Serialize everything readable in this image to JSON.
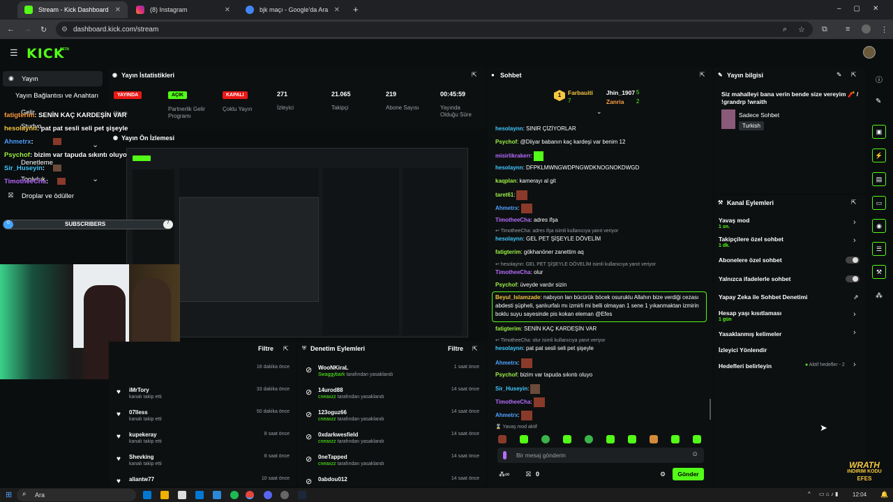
{
  "browser": {
    "tabs": [
      {
        "label": "Stream - Kick Dashboard",
        "active": true
      },
      {
        "label": "(8) Instagram",
        "active": false
      },
      {
        "label": "bjk maçı - Google'da Ara",
        "active": false
      }
    ],
    "url": "dashboard.kick.com/stream"
  },
  "kick": {
    "logo": "KICK",
    "beta": "BETA"
  },
  "sidebar": {
    "items": [
      {
        "label": "Yayın"
      },
      {
        "label": "Yayın Bağlantısı ve Anahtarı"
      },
      {
        "label": "Gelir"
      },
      {
        "label": "Studyo"
      },
      {
        "label": "Denetleme"
      },
      {
        "label": "Topluluk"
      },
      {
        "label": "Droplar ve ödüller"
      }
    ]
  },
  "overlay": {
    "chat": [
      {
        "user": "fatigterim",
        "text": ": SENİN KAÇ KARDEŞİN VAR"
      },
      {
        "user": "hesolaynn",
        "text": ": pat pat sesli seli pet şişeyle"
      },
      {
        "user": "Ahmetrx",
        "text": ":"
      },
      {
        "user": "Psychof",
        "text": ": bizim var tapuda sıkıntı oluyo"
      },
      {
        "user": "Sir_Huseyin",
        "text": ":"
      },
      {
        "user": "TimotheeCha",
        "text": ":"
      }
    ],
    "subs_label": "SUBSCRIBERS",
    "subs_left": "0",
    "subs_right": "7"
  },
  "stats": {
    "title": "Yayın İstatistikleri",
    "items": [
      {
        "badge": "YAYINDA",
        "label": "Yayın"
      },
      {
        "badge": "AÇIK",
        "label": "Partnerlik Gelir Programı"
      },
      {
        "badge": "KAPALI",
        "label": "Çoklu Yayın"
      },
      {
        "value": "271",
        "label": "İzleyici"
      },
      {
        "value": "21.065",
        "label": "Takipçi"
      },
      {
        "value": "219",
        "label": "Abone Sayısı"
      },
      {
        "value": "00:45:59",
        "label": "Yayında Olduğu Süre"
      }
    ]
  },
  "preview": {
    "title": "Yayın Ön İzlemesi"
  },
  "activity": {
    "filter": "Filtre",
    "items": [
      {
        "name": "",
        "sub": "",
        "time": "16 dakika önce"
      },
      {
        "name": "iMrTory",
        "sub": "kanalı takip etti",
        "time": "33 dakika önce"
      },
      {
        "name": "07lless",
        "sub": "kanalı takip etti",
        "time": "50 dakika önce"
      },
      {
        "name": "kupekeray",
        "sub": "kanalı takip etti",
        "time": "8 saat önce"
      },
      {
        "name": "Shevking",
        "sub": "kanalı takip etti",
        "time": "8 saat önce"
      },
      {
        "name": "aliantw77",
        "sub": "",
        "time": "10 saat önce"
      }
    ]
  },
  "moderation": {
    "title": "Denetim Eylemleri",
    "filter": "Filtre",
    "items": [
      {
        "name": "WooNKiraL",
        "by": "Swaggybark",
        "sub": "tarafından yasaklandı",
        "time": "1 saat önce"
      },
      {
        "name": "14urod88",
        "by": "cneaxzz",
        "sub": "tarafından yasaklandı",
        "time": "14 saat önce"
      },
      {
        "name": "123oguz66",
        "by": "cneaxzz",
        "sub": "tarafından yasaklandı",
        "time": "14 saat önce"
      },
      {
        "name": "0xdarkwesfield",
        "by": "cneaxzz",
        "sub": "tarafından yasaklandı",
        "time": "14 saat önce"
      },
      {
        "name": "0neTapped",
        "by": "cneaxzz",
        "sub": "tarafından yasaklandı",
        "time": "14 saat önce"
      },
      {
        "name": "0abdou012",
        "by": "",
        "sub": "",
        "time": "14 saat önce"
      }
    ]
  },
  "chat": {
    "title": "Sohbet",
    "top": [
      {
        "name": "Farbauiti",
        "count": "7"
      },
      {
        "name": "Jhin_1907",
        "count": "5"
      },
      {
        "name": "Zanria",
        "count": "2"
      }
    ],
    "lines": [
      {
        "user": "hesolaynn",
        "text": ": SINIR ÇİZİYORLAR"
      },
      {
        "user": "Psychof",
        "text": ": @Diiyar babanın kaç kardeşi var benim 12"
      },
      {
        "user": "misirlikrakerr",
        "text": ":"
      },
      {
        "user": "hesolaynn",
        "text": ": DFPKLMWNGWDPNGWDKNOGNOKDWGD"
      },
      {
        "user": "kaqplan",
        "text": ": kamerayı al git"
      },
      {
        "user": "taret61",
        "text": ":"
      },
      {
        "user": "Ahmetrx",
        "text": ":"
      },
      {
        "user": "TimotheeCha",
        "text": ": adres ifşa"
      },
      {
        "user": "",
        "text": "TimotheeCha: adres ifşa isimli kullanıcıya yanıt veriyor"
      },
      {
        "user": "hesolaynn",
        "text": ": GEL PET ŞİŞEYLE DÖVELİM"
      },
      {
        "user": "fatigterim",
        "text": ": gökhanöner zanettim aq"
      },
      {
        "user": "",
        "text": "hesolaynn: GEL PET ŞİŞEYLE DÖVELİM isimli kullanıcıya yanıt veriyor"
      },
      {
        "user": "TimotheeCha",
        "text": ": olur"
      },
      {
        "user": "Psychof",
        "text": ": üveyde vardır sizin"
      },
      {
        "user": "fatigterim",
        "text": ": SENİN KAÇ KARDEŞİN VAR"
      },
      {
        "user": "",
        "text": "TimotheeCha: olur isimli kullanıcıya yanıt veriyor"
      },
      {
        "user": "hesolaynn",
        "text": ": pat pat sesli seli pet şişeyle"
      },
      {
        "user": "Ahmetrx",
        "text": ":"
      },
      {
        "user": "Psychof",
        "text": ": bizim var tapuda sıkıntı oluyo"
      },
      {
        "user": "Sir_Huseyin",
        "text": ":"
      },
      {
        "user": "TimotheeCha",
        "text": ":"
      },
      {
        "user": "Ahmetrx",
        "text": ":"
      }
    ],
    "highlight": {
      "user": "Beyul_Islamzade",
      "text": ": nabıyon lan bücürük böcek osuruklu Allahın bize verdiği cezası abdesti şüpheli, şanlıurfalı mı izmirli mi belli olmayan 1 sene 1 yıkanmaktan izmirin boklu suyu sayesinde pis kokan eleman @Efes"
    },
    "slow_mode": "Yavaş mod aktif",
    "placeholder": "Bir mesaj gönderin",
    "points": "0",
    "send": "Gönder"
  },
  "info": {
    "title": "Yayın bilgisi",
    "stream_title": "Siz mahalleyi bana verin bende size vereyim 🧨 / !grandrp !wraith",
    "category": "Sadece Sohbet",
    "tag": "Turkish"
  },
  "actions": {
    "title": "Kanal Eylemleri",
    "items": [
      {
        "label": "Yavaş mod",
        "sub": "1 sn."
      },
      {
        "label": "Takipçilere özel sohbet",
        "sub": "1 dk."
      },
      {
        "label": "Abonelere özel sohbet",
        "sub": ""
      },
      {
        "label": "Yalnızca ifadelerle sohbet",
        "sub": ""
      },
      {
        "label": "Yapay Zeka ile Sohbet Denetimi",
        "sub": ""
      },
      {
        "label": "Hesap yaşı kısıtlaması",
        "sub": "1 gün"
      },
      {
        "label": "Yasaklanmış kelimeler",
        "sub": ""
      },
      {
        "label": "İzleyici Yönlendir",
        "sub": ""
      },
      {
        "label": "Hedefleri belirleyin",
        "sub": ""
      }
    ],
    "goals_status": "Aktif hedefler - 2"
  },
  "watermark": {
    "line1": "WRATH",
    "line2": "INDIRIM KODU",
    "line3": "EFES"
  },
  "taskbar": {
    "search": "Ara",
    "time": "12:04"
  },
  "colors": {
    "kick_green": "#53fc18",
    "live_red": "#e91916"
  }
}
